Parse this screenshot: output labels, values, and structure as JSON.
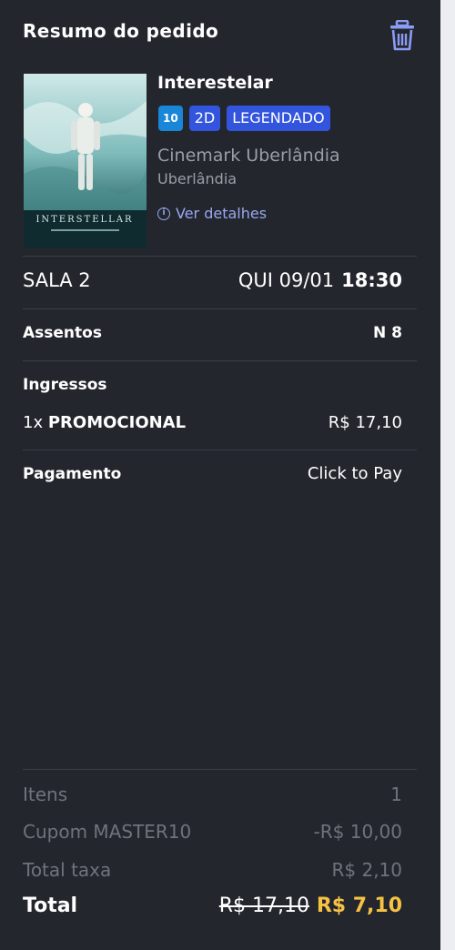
{
  "header": {
    "title": "Resumo do pedido",
    "trash_icon": "trash-icon"
  },
  "movie": {
    "title": "Interestelar",
    "age_rating": "10",
    "format": "2D",
    "language": "LEGENDADO",
    "cinema": "Cinemark Uberlândia",
    "city": "Uberlândia",
    "details_link": "Ver detalhes",
    "poster_text": "INTERSTELLAR"
  },
  "session": {
    "room": "SALA 2",
    "date": "QUI 09/01",
    "time": "18:30"
  },
  "seats": {
    "label": "Assentos",
    "value": "N 8"
  },
  "tickets": {
    "label": "Ingressos",
    "qty": "1x",
    "type": "PROMOCIONAL",
    "price": "R$ 17,10"
  },
  "payment": {
    "label": "Pagamento",
    "value": "Click to Pay"
  },
  "summary": {
    "items_label": "Itens",
    "items_value": "1",
    "coupon_label": "Cupom MASTER10",
    "coupon_value": "-R$ 10,00",
    "fee_label": "Total taxa",
    "fee_value": "R$ 2,10",
    "total_label": "Total",
    "total_original": "R$ 17,10",
    "total_final": "R$ 7,10"
  },
  "colors": {
    "panel_bg": "#23262d",
    "accent_price": "#f6c244",
    "badge_blue": "#3355dd",
    "age_blue": "#1a86d8",
    "link": "#98a8f0"
  }
}
